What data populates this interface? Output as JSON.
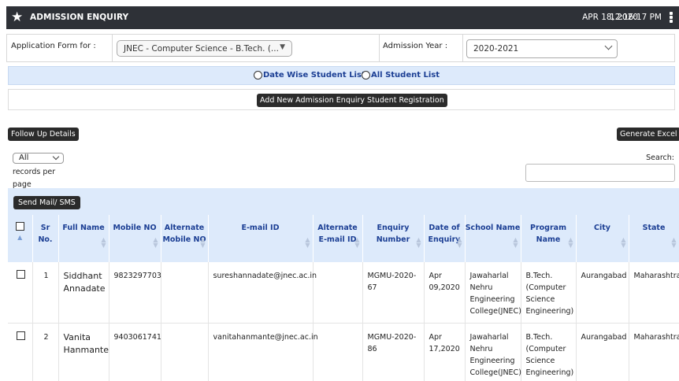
{
  "header": {
    "title": "ADMISSION ENQUIRY",
    "date": "APR 18, 2020",
    "time": "12:16:17 PM"
  },
  "form": {
    "application_label": "Application Form for :",
    "application_value": "JNEC - Computer Science - B.Tech. (...",
    "year_label": "Admission Year :",
    "year_value": "2020-2021"
  },
  "view_options": {
    "date_wise": "Date Wise Student List",
    "all": "All Student List"
  },
  "buttons": {
    "add_new": "Add New Admission Enquiry Student Registration",
    "follow_up": "Follow Up Details",
    "generate_excel": "Generate Excel",
    "send_mail": "Send Mail/ SMS"
  },
  "list_controls": {
    "records_value": "All",
    "records_text_1": "records per",
    "records_text_2": "page",
    "search_label": "Search:"
  },
  "table": {
    "columns": [
      {
        "key": "select",
        "label": ""
      },
      {
        "key": "sr",
        "label": "Sr No."
      },
      {
        "key": "name",
        "label": "Full Name"
      },
      {
        "key": "mobile",
        "label": "Mobile NO"
      },
      {
        "key": "alt_mobile",
        "label": "Alternate Mobile NO"
      },
      {
        "key": "email",
        "label": "E-mail ID"
      },
      {
        "key": "alt_email",
        "label": "Alternate E-mail ID"
      },
      {
        "key": "enquiry_no",
        "label": "Enquiry Number"
      },
      {
        "key": "date",
        "label": "Date of Enquiry"
      },
      {
        "key": "school",
        "label": "School Name"
      },
      {
        "key": "program",
        "label": "Program Name"
      },
      {
        "key": "city",
        "label": "City"
      },
      {
        "key": "state",
        "label": "State"
      }
    ],
    "rows": [
      {
        "sr": "1",
        "name": "Siddhant Annadate",
        "mobile": "9823297703",
        "alt_mobile": "",
        "email": "sureshannadate@jnec.ac.in",
        "alt_email": "",
        "enquiry_no": "MGMU-2020-67",
        "date": "Apr 09,2020",
        "school": "Jawaharlal Nehru Engineering College(JNEC)",
        "program": "B.Tech. (Computer Science Engineering)",
        "city": "Aurangabad",
        "state": "Maharashtra"
      },
      {
        "sr": "2",
        "name": "Vanita Hanmante",
        "mobile": "9403061741",
        "alt_mobile": "",
        "email": "vanitahanmante@jnec.ac.in",
        "alt_email": "",
        "enquiry_no": "MGMU-2020-86",
        "date": "Apr 17,2020",
        "school": "Jawaharlal Nehru Engineering College(JNEC)",
        "program": "B.Tech. (Computer Science Engineering)",
        "city": "Aurangabad",
        "state": "Maharashtra"
      }
    ]
  },
  "colors": {
    "title_bar": "#2e3137",
    "header_bg": "#ddeafb",
    "header_text": "#1c3f94",
    "button_dark": "#2b2b2b"
  }
}
